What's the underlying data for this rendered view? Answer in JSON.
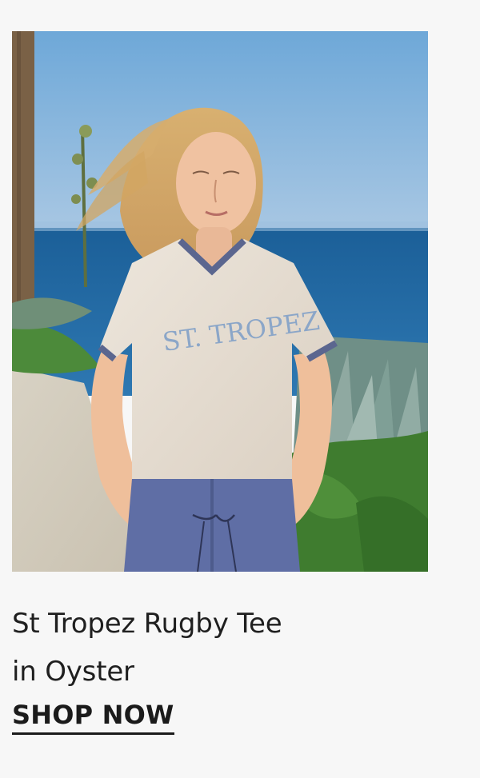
{
  "product": {
    "title_line1": "St Tropez Rugby Tee",
    "title_line2": "in Oyster",
    "shirt_print": "ST. TROPEZ"
  },
  "cta": {
    "label": "SHOP NOW"
  },
  "colors": {
    "background": "#f7f7f7",
    "text": "#1f1f1f",
    "sky": "#7fb3df",
    "sea": "#1f5f95",
    "shirt": "#e7ded3",
    "shirt_trim": "#5b668f",
    "shorts": "#5f6ea5"
  }
}
